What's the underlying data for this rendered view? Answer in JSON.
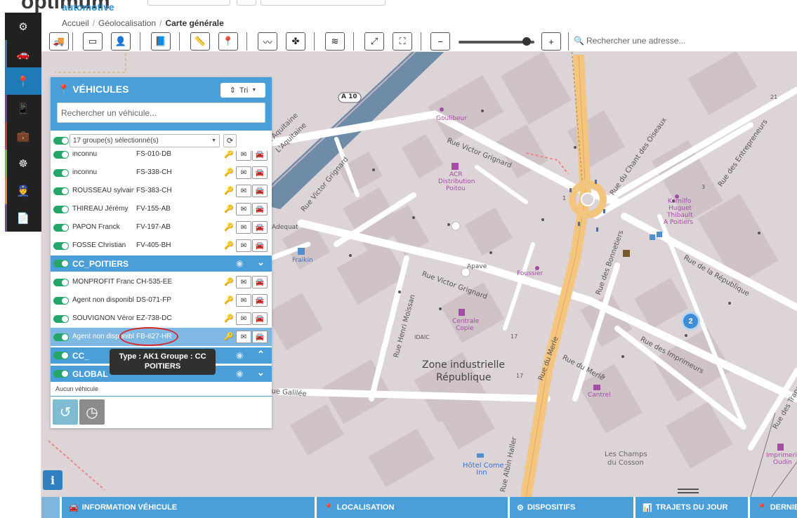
{
  "brand": {
    "name": "optimum",
    "sub": "automotive"
  },
  "breadcrumb": {
    "home": "Accueil",
    "section": "Géolocalisation",
    "current": "Carte générale"
  },
  "toolbar": {
    "buttons": [
      "truck-icon",
      "fuel-card-icon",
      "driver-icon",
      "book-icon",
      "ruler-icon",
      "pin-icon",
      "route-icon",
      "poi-cluster-icon",
      "layers-icon",
      "fullscreen-icon",
      "zoom-area-icon",
      "zoom-out-icon",
      "zoom-in-icon"
    ],
    "search_placeholder": "Rechercher une adresse..."
  },
  "panel": {
    "title": "VÉHICULES",
    "sort_label": "Tri",
    "search_placeholder": "Rechercher un véhicule...",
    "group_select": "17 groupe(s) sélectionné(s)",
    "vehicles_top": [
      {
        "name": "inconnu",
        "plate": "FS-010-DB",
        "key": "green"
      },
      {
        "name": "inconnu",
        "plate": "FS-338-CH",
        "key": "orange"
      },
      {
        "name": "ROUSSEAU sylvain",
        "plate": "FS-383-CH",
        "key": "green"
      },
      {
        "name": "THIREAU Jérémy",
        "plate": "FV-155-AB",
        "key": "green"
      },
      {
        "name": "PAPON Franck",
        "plate": "FV-197-AB",
        "key": "orange"
      },
      {
        "name": "FOSSE Christian",
        "plate": "FV-405-BH",
        "key": "red"
      }
    ],
    "group_poitiers": "CC_POITIERS",
    "vehicles_poitiers": [
      {
        "name": "MONPROFIT Franck",
        "plate": "CH-535-EE",
        "key": "red"
      },
      {
        "name": "Agent non disponible",
        "plate": "DS-071-FP",
        "key": "green"
      },
      {
        "name": "SOUVIGNON Véronique",
        "plate": "EZ-738-DC",
        "key": "red"
      },
      {
        "name": "Agent non disponible",
        "plate": "FB-627-HR",
        "key": "red"
      }
    ],
    "group_next": "CC_",
    "group_global": "GLOBAL",
    "empty_text": "Aucun véhicule",
    "tooltip_line1": "Type : AK1 Groupe : CC",
    "tooltip_line2": "POITIERS"
  },
  "map": {
    "highway_badge": "A 10",
    "labels": {
      "rue_victor_grignard_1": "Rue Victor Grignard",
      "rue_victor_grignard_2": "Rue Victor Grignard",
      "rue_victor_grignard_3": "Rue Victor Grignard",
      "rue_chant_oiseaux": "Rue du Chant des Oiseaux",
      "rue_entrepreneurs": "Rue des Entrepreneurs",
      "rue_republique": "Rue de la République",
      "rue_bonnetiers": "Rue des Bonnetiers",
      "rue_imprimeurs": "Rue des Imprimeurs",
      "rue_merle_1": "Rue du Merle",
      "rue_merle_2": "Rue du Merle",
      "rue_henri_moissan": "Rue Henri Moissan",
      "rue_albin_haller": "Rue Albin Haller",
      "rue_galilee": "ue Galilée",
      "rue_transports": "Rue des Transp",
      "aquitaine_1": "L'Aquitaine",
      "aquitaine_2": "L'Aquitaine",
      "zone_line1": "Zone industrielle",
      "zone_line2": "République",
      "champs_line1": "Les Champs",
      "champs_line2": "du Cosson",
      "idaic": "IDAIC",
      "adequat": "Adequat",
      "fraikin": "Fraikin",
      "apave": "Apave",
      "foussier": "Foussier",
      "centrale_copie_1": "Centrale",
      "centrale_copie_2": "Copie",
      "goulibeur": "Goulibeur",
      "acr_1": "ACR",
      "acr_2": "Distribution",
      "acr_3": "Poitou",
      "komilfo_1": "Komilfo",
      "komilfo_2": "Huguet",
      "komilfo_3": "Thibault",
      "komilfo_4": "A Poitiers",
      "cantrel": "Cantrel",
      "hotel_1": "Hôtel Come",
      "hotel_2": "Inn",
      "imprimerie_1": "Imprimerie",
      "imprimerie_2": "Oudin",
      "num_1": "1",
      "num_3": "3",
      "num_17a": "17",
      "num_17b": "17",
      "num_5": "5",
      "num_21": "21"
    },
    "cluster_count": "2"
  },
  "bottom_tabs": [
    {
      "icon": "car-icon",
      "label": "INFORMATION VÉHICULE"
    },
    {
      "icon": "pin-icon",
      "label": "LOCALISATION"
    },
    {
      "icon": "gear-icon",
      "label": "DISPOSITIFS"
    },
    {
      "icon": "chart-icon",
      "label": "TRAJETS DU JOUR"
    },
    {
      "icon": "pin-icon",
      "label": "DERNIER"
    }
  ]
}
